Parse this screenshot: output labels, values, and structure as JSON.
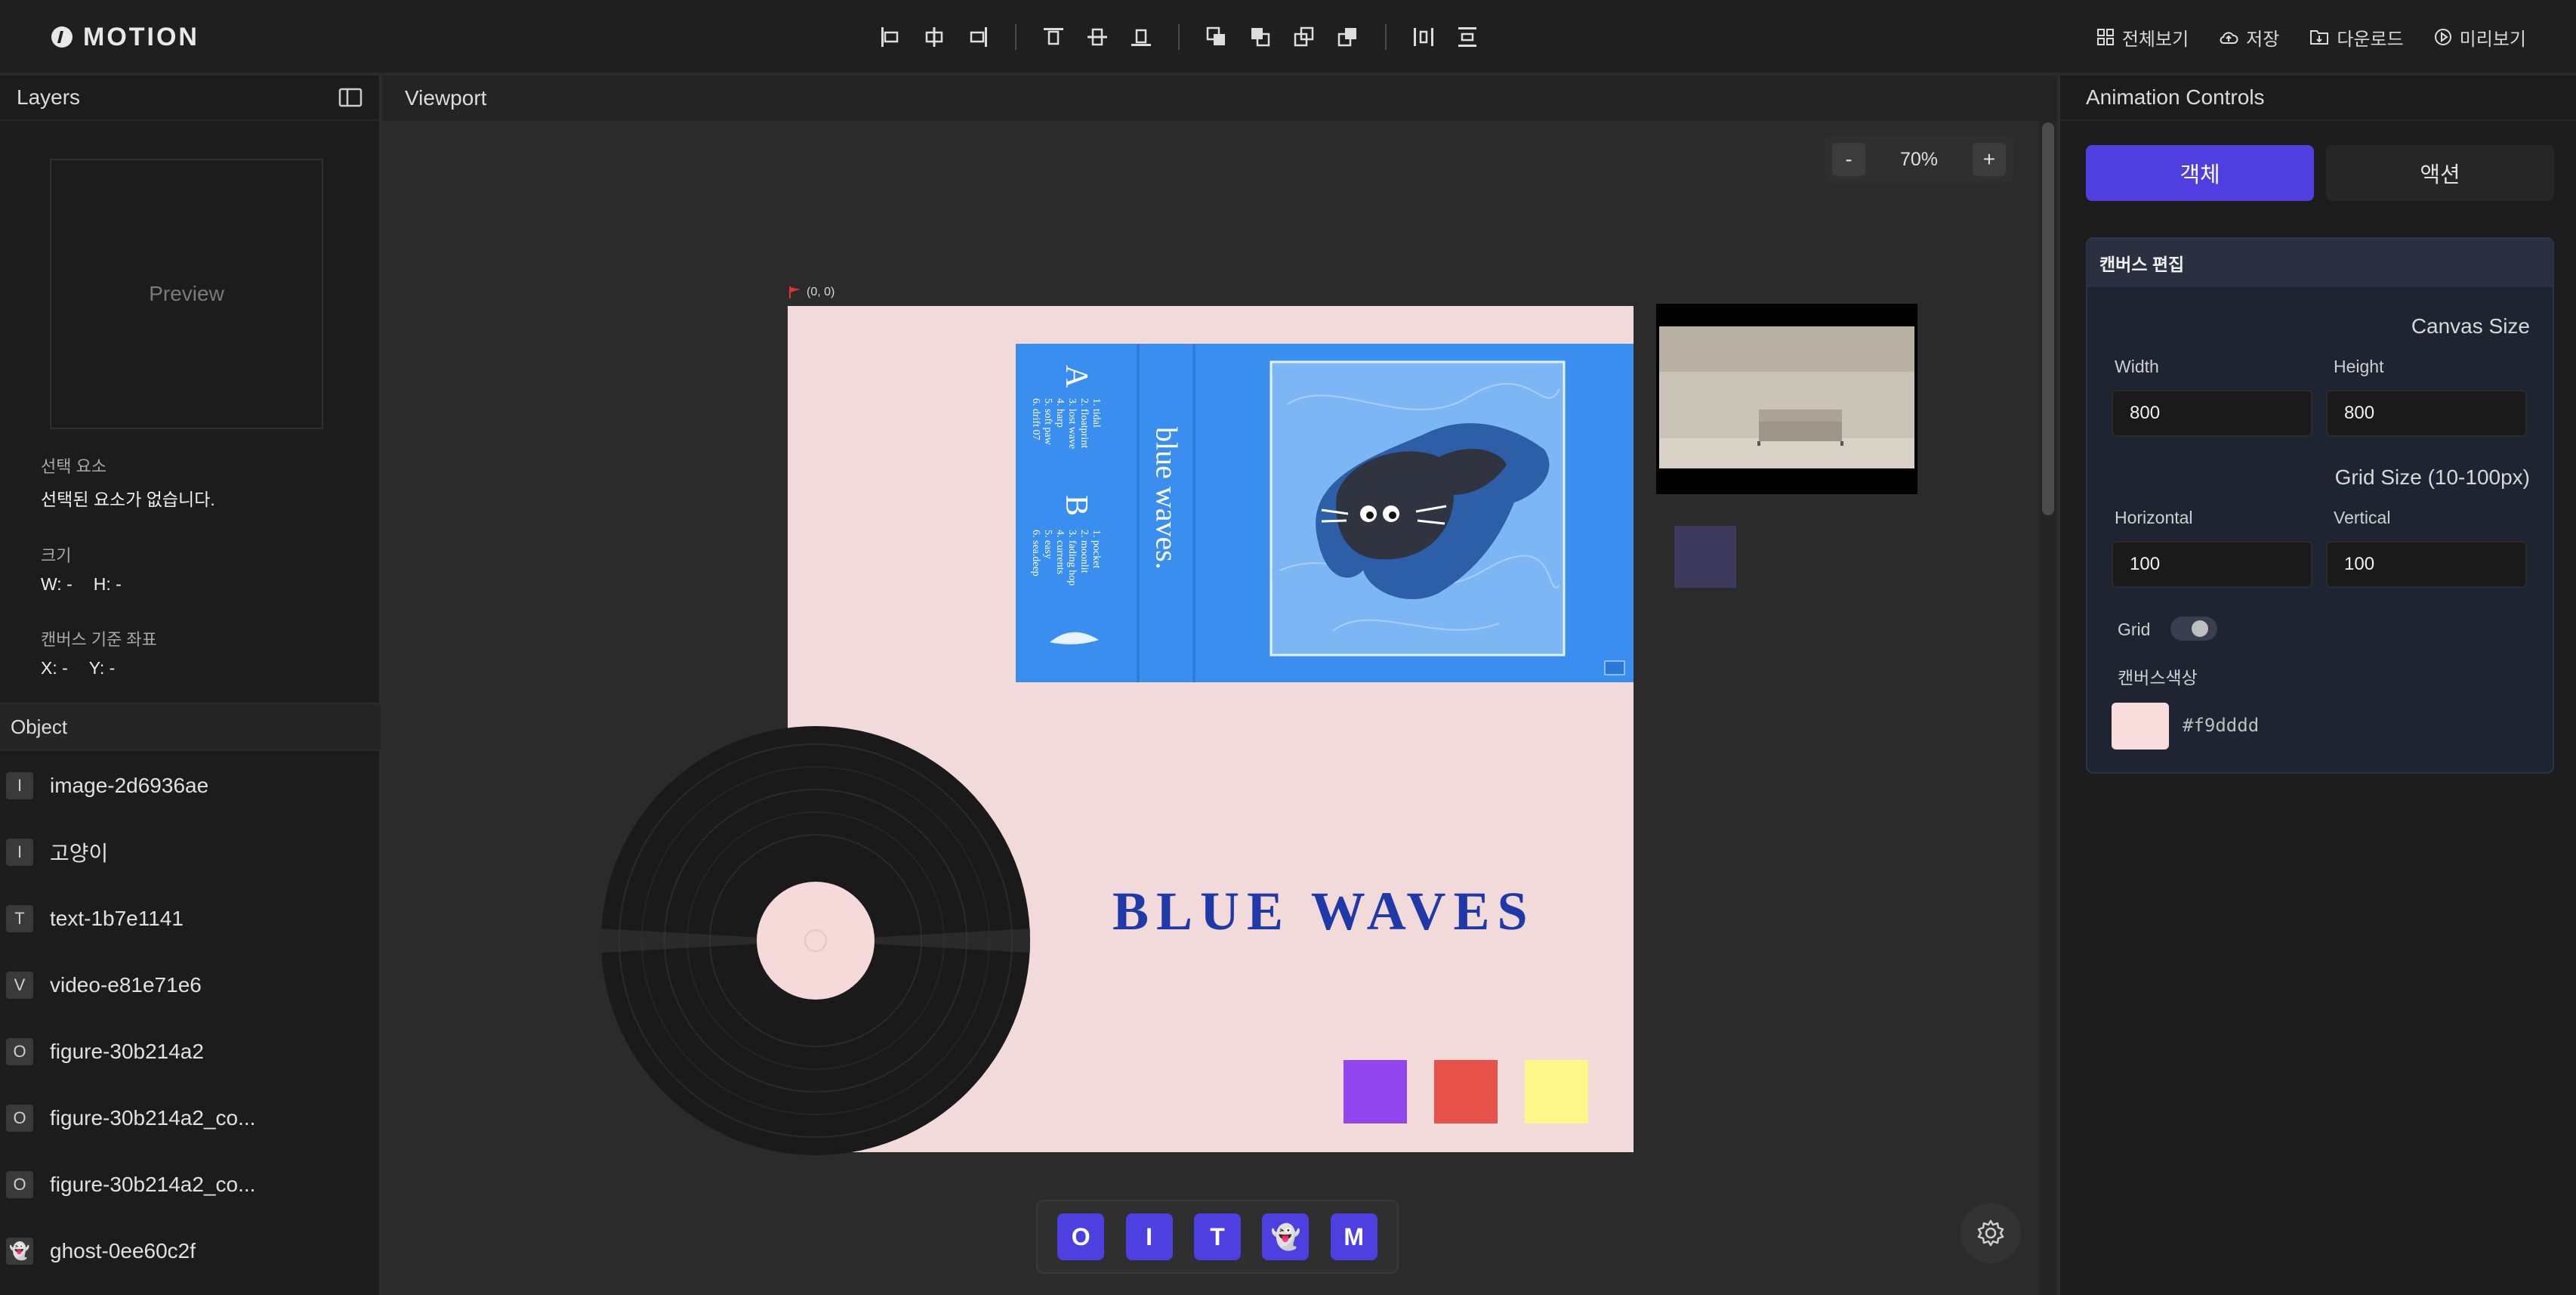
{
  "app": {
    "name": "MOTION"
  },
  "toolbar": {
    "groups": [
      [
        "align-left-icon",
        "align-center-h-icon",
        "align-right-icon"
      ],
      [
        "align-top-icon",
        "align-middle-icon",
        "align-bottom-icon"
      ],
      [
        "bring-front-icon",
        "bring-forward-icon",
        "send-backward-icon",
        "send-back-icon"
      ],
      [
        "distribute-h-icon",
        "distribute-v-icon"
      ]
    ]
  },
  "top_actions": [
    {
      "label": "전체보기",
      "icon": "grid-icon"
    },
    {
      "label": "저장",
      "icon": "cloud-save-icon"
    },
    {
      "label": "다운로드",
      "icon": "download-icon"
    },
    {
      "label": "미리보기",
      "icon": "play-icon"
    }
  ],
  "layers": {
    "title": "Layers",
    "preview_label": "Preview",
    "selection_label": "선택 요소",
    "selection_value": "선택된 요소가 없습니다.",
    "size_label": "크기",
    "size_w": "W: -",
    "size_h": "H: -",
    "coord_label": "캔버스 기준 좌표",
    "coord_x": "X: -",
    "coord_y": "Y: -",
    "object_header": "Object",
    "objects": [
      {
        "badge": "I",
        "name": "image-2d6936ae"
      },
      {
        "badge": "I",
        "name": "고양이"
      },
      {
        "badge": "T",
        "name": "text-1b7e1141"
      },
      {
        "badge": "V",
        "name": "video-e81e71e6"
      },
      {
        "badge": "O",
        "name": "figure-30b214a2"
      },
      {
        "badge": "O",
        "name": "figure-30b214a2_co..."
      },
      {
        "badge": "O",
        "name": "figure-30b214a2_co..."
      },
      {
        "badge": "👻",
        "name": "ghost-0ee60c2f"
      }
    ]
  },
  "viewport": {
    "title": "Viewport",
    "zoom_minus": "-",
    "zoom_value": "70%",
    "zoom_plus": "+",
    "origin_label": "(0, 0)",
    "canvas_text": "BLUE WAVES",
    "cassette": {
      "spine_title": "blue waves.",
      "side_a": "A",
      "side_b": "B",
      "tracks_a": [
        "1. tidal",
        "2. floatprint",
        "3. lost wave",
        "4. harp",
        "5. soft paw",
        "6. drift 07"
      ],
      "tracks_b": [
        "1. pocket",
        "2. moonlit",
        "3. fading hop",
        "4. currents",
        "5. easy",
        "6. sea.deep"
      ]
    },
    "square_colors": [
      "#9246ef",
      "#e8524a",
      "#fdf78a"
    ],
    "add_buttons": [
      "O",
      "I",
      "T",
      "👻",
      "M"
    ]
  },
  "controls": {
    "title": "Animation Controls",
    "tab_object": "객체",
    "tab_action": "액션",
    "panel_title": "캔버스 편집",
    "canvas_size_title": "Canvas Size",
    "width_label": "Width",
    "width_value": "800",
    "height_label": "Height",
    "height_value": "800",
    "grid_size_title": "Grid Size (10-100px)",
    "horizontal_label": "Horizontal",
    "horizontal_value": "100",
    "vertical_label": "Vertical",
    "vertical_value": "100",
    "grid_label": "Grid",
    "grid_on": false,
    "color_label": "캔버스색상",
    "color_value": "#f9dddd"
  },
  "colors": {
    "accent": "#4f3fe0",
    "canvas_bg": "#f9dddd",
    "title_blue": "#1f3aa8",
    "cassette_blue": "#3a8ef0"
  }
}
